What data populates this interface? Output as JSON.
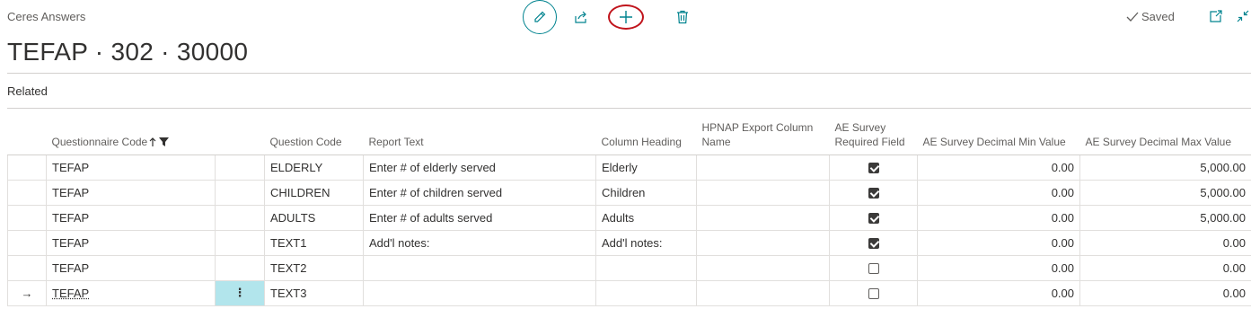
{
  "app": {
    "name": "Ceres Answers"
  },
  "toolbar": {
    "edit_icon": "pencil-icon",
    "share_icon": "share-icon",
    "new_icon": "plus-icon",
    "delete_icon": "trash-icon",
    "highlight_color": "#c0131b"
  },
  "status": {
    "saved_label": "Saved"
  },
  "page": {
    "title": "TEFAP · 302 · 30000"
  },
  "related": {
    "label": "Related"
  },
  "columns": {
    "questionnaire_code": "Questionnaire Code",
    "question_code": "Question Code",
    "report_text": "Report Text",
    "column_heading": "Column Heading",
    "hpnap_export": "HPNAP Export Column Name",
    "ae_required": "AE Survey Required Field",
    "ae_min": "AE Survey Decimal Min Value",
    "ae_max": "AE Survey Decimal Max Value"
  },
  "rows": [
    {
      "questionnaire_code": "TEFAP",
      "question_code": "ELDERLY",
      "report_text": "Enter # of elderly served",
      "column_heading": "Elderly",
      "hpnap_export": "",
      "ae_required": true,
      "ae_min": "0.00",
      "ae_max": "5,000.00"
    },
    {
      "questionnaire_code": "TEFAP",
      "question_code": "CHILDREN",
      "report_text": "Enter # of children served",
      "column_heading": "Children",
      "hpnap_export": "",
      "ae_required": true,
      "ae_min": "0.00",
      "ae_max": "5,000.00"
    },
    {
      "questionnaire_code": "TEFAP",
      "question_code": "ADULTS",
      "report_text": "Enter # of adults served",
      "column_heading": "Adults",
      "hpnap_export": "",
      "ae_required": true,
      "ae_min": "0.00",
      "ae_max": "5,000.00"
    },
    {
      "questionnaire_code": "TEFAP",
      "question_code": "TEXT1",
      "report_text": "Add'l notes:",
      "column_heading": "Add'l notes:",
      "hpnap_export": "",
      "ae_required": true,
      "ae_min": "0.00",
      "ae_max": "0.00"
    },
    {
      "questionnaire_code": "TEFAP",
      "question_code": "TEXT2",
      "report_text": "",
      "column_heading": "",
      "hpnap_export": "",
      "ae_required": false,
      "ae_min": "0.00",
      "ae_max": "0.00"
    },
    {
      "questionnaire_code": "TEFAP",
      "question_code": "TEXT3",
      "report_text": "",
      "column_heading": "",
      "hpnap_export": "",
      "ae_required": false,
      "ae_min": "0.00",
      "ae_max": "0.00",
      "current": true
    }
  ],
  "row_indicator": "→",
  "row_menu": "⋮"
}
